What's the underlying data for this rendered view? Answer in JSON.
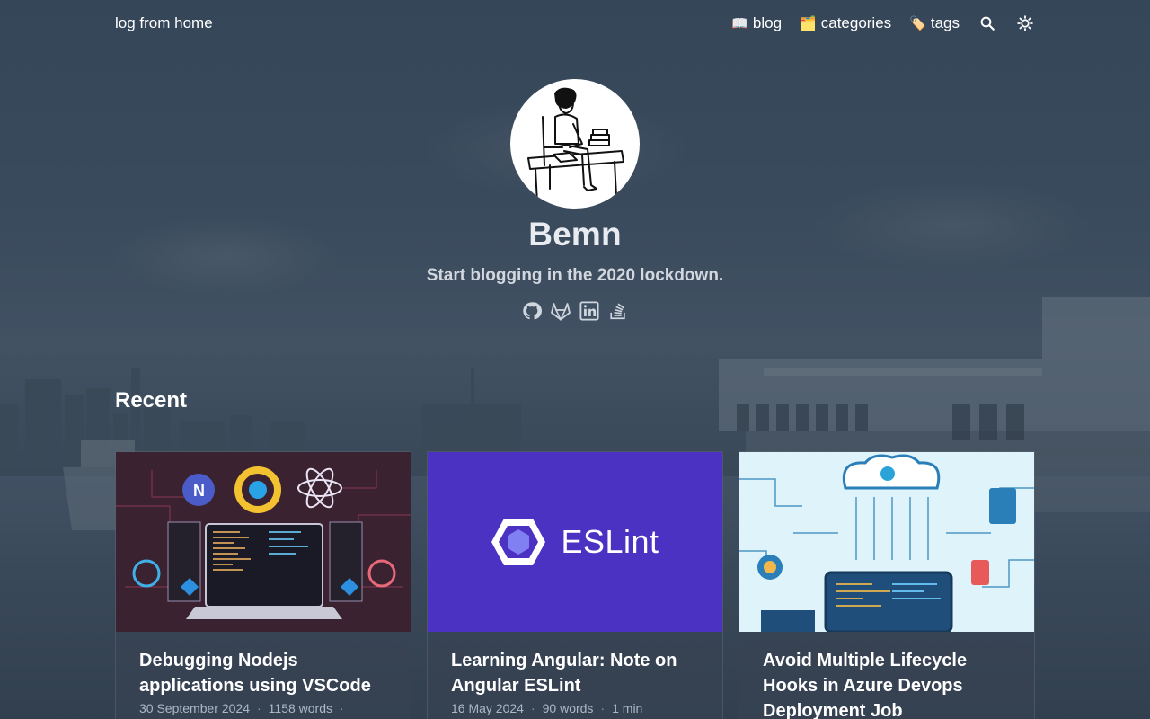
{
  "site": {
    "brand": "log from home"
  },
  "nav": {
    "items": [
      {
        "emoji": "📖",
        "label": "blog"
      },
      {
        "emoji": "🗂️",
        "label": "categories"
      },
      {
        "emoji": "🏷️",
        "label": "tags"
      }
    ],
    "search_icon": "search-icon",
    "theme_icon": "theme-toggle-icon"
  },
  "profile": {
    "name": "Bemn",
    "tagline": "Start blogging in the 2020 lockdown.",
    "socials": [
      "github-icon",
      "gitlab-icon",
      "linkedin-icon",
      "stackoverflow-icon"
    ]
  },
  "recent": {
    "title": "Recent",
    "posts": [
      {
        "title": "Debugging Nodejs applications using VSCode",
        "date": "30 September 2024",
        "words": "1158 words",
        "read": ""
      },
      {
        "title": "Learning Angular: Note on Angular ESLint",
        "date": "16 May 2024",
        "words": "90 words",
        "read": "1 min",
        "thumb_text": "ESLint",
        "thumb_color": "#4b32c3"
      },
      {
        "title": "Avoid Multiple Lifecycle Hooks in Azure Devops Deployment Job",
        "date": "",
        "words": "",
        "read": ""
      }
    ]
  }
}
